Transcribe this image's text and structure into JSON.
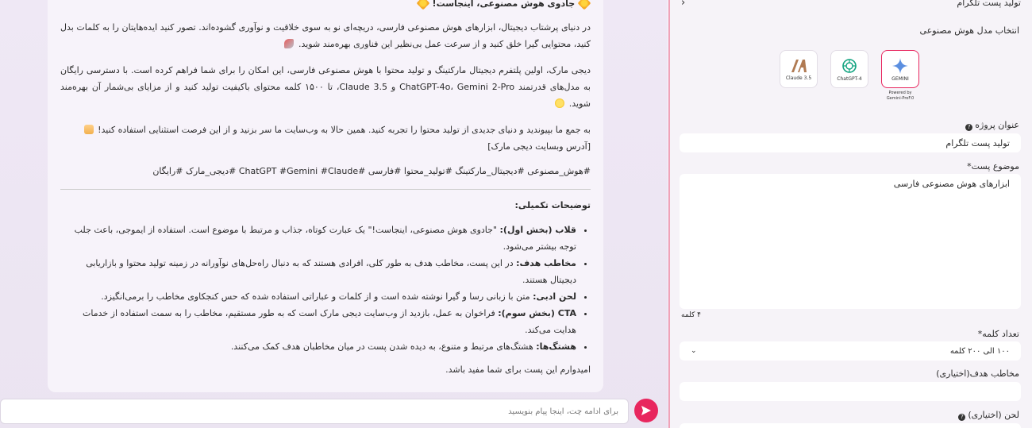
{
  "message": {
    "title": "جادوی هوش مصنوعی، اینجاست!",
    "para1": "در دنیای پرشتاب دیجیتال، ابزارهای هوش مصنوعی فارسی، دریچه‌ای نو به سوی خلاقیت و نوآوری گشوده‌اند. تصور کنید ایده‌هایتان را به کلمات بدل کنید، محتوایی گیرا خلق کنید و از سرعت عمل بی‌نظیر این فناوری بهره‌مند شوید.",
    "para2": "دیجی مارک، اولین پلتفرم دیجیتال مارکتینگ و تولید محتوا با هوش مصنوعی فارسی، این امکان را برای شما فراهم کرده است. با دسترسی رایگان به مدل‌های قدرتمند ChatGPT-4o، Gemini 2-Pro و Claude 3.5، تا ۱۵۰۰ کلمه محتوای باکیفیت تولید کنید و از مزایای بی‌شمار آن بهره‌مند شوید.",
    "para3": "به جمع ما بپیوندید و دنیای جدیدی از تولید محتوا را تجربه کنید. همین حالا به وب‌سایت ما سر بزنید و از این فرصت استثنایی استفاده کنید!",
    "para3_link": "[آدرس وبسایت دیجی مارک]",
    "hashtags": "#هوش_مصنوعی #دیجیتال_مارکتینگ #تولید_محتوا #فارسی #ChatGPT #Gemini #Claude #دیجی_مارک #رایگان",
    "notes_title": "توضیحات تکمیلی:",
    "notes": [
      {
        "label": "قلاب (بخش اول):",
        "text": " \"جادوی هوش مصنوعی، اینجاست!\" یک عبارت کوتاه، جذاب و مرتبط با موضوع است. استفاده از ایموجی، باعث جلب توجه بیشتر می‌شود."
      },
      {
        "label": "مخاطب هدف:",
        "text": " در این پست، مخاطب هدف به طور کلی، افرادی هستند که به دنبال راه‌حل‌های نوآورانه در زمینه تولید محتوا و بازاریابی دیجیتال هستند."
      },
      {
        "label": "لحن ادبی:",
        "text": " متن با زبانی رسا و گیرا نوشته شده است و از کلمات و عباراتی استفاده شده که حس کنجکاوی مخاطب را برمی‌انگیزد."
      },
      {
        "label": "CTA (بخش سوم):",
        "text": " فراخوان به عمل، بازدید از وب‌سایت دیجی مارک است که به طور مستقیم، مخاطب را به سمت استفاده از خدمات هدایت می‌کند."
      },
      {
        "label": "هشتگ‌ها:",
        "text": " هشتگ‌های مرتبط و متنوع، به دیده شدن پست در میان مخاطبان هدف کمک می‌کنند."
      }
    ],
    "closing": "امیدوارم این پست برای شما مفید باشد."
  },
  "chat": {
    "placeholder": "برای ادامه چت، اینجا پیام بنویسید"
  },
  "panel": {
    "header_title": "تولید پست تلگرام",
    "model_label": "انتخاب مدل هوش مصنوعی",
    "models": [
      {
        "name": "GEMINI",
        "selected": true
      },
      {
        "name": "ChatGPT-4",
        "selected": false
      },
      {
        "name": "Claude 3.5",
        "selected": false
      }
    ],
    "powered_by": "Powered by",
    "powered_model": "Gemini-ProF.0",
    "project_title_label": "عنوان پروژه",
    "project_title_value": "تولید پست تلگرام",
    "topic_label": "موضوع پست*",
    "topic_value": "ابزارهای هوش مصنوعی فارسی",
    "word_count_hint": "۴ کلمه",
    "word_count_label": "تعداد کلمه*",
    "word_count_value": "۱۰۰ الی ۲۰۰ کلمه",
    "audience_label": "مخاطب هدف(اختیاری)",
    "tone_label": "لحن (اختیاری)"
  },
  "colors": {
    "accent": "#e8265e",
    "panel_border": "#f0a3b8"
  }
}
